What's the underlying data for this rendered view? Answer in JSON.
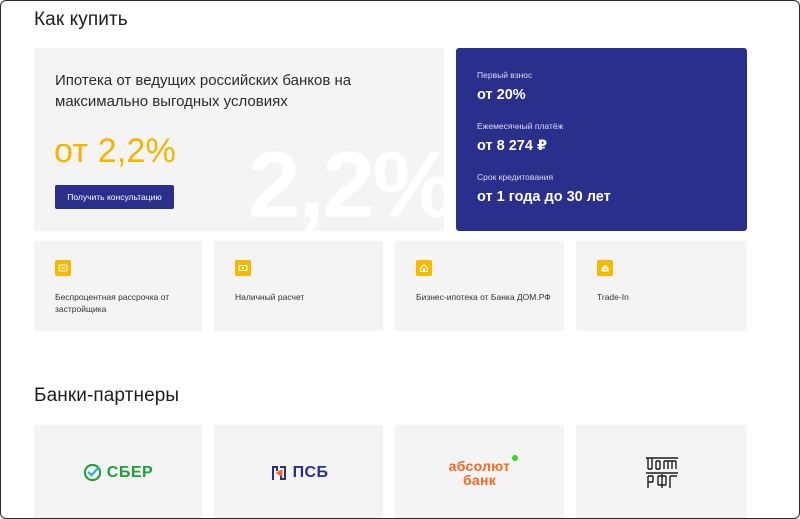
{
  "how_to_buy": {
    "title": "Как купить",
    "promo": {
      "title": "Ипотека от ведущих российских банков на максимально выгодных условиях",
      "rate": "от 2,2%",
      "background_rate": "2,2%",
      "button_label": "Получить консультацию"
    },
    "info": {
      "down_payment_label": "Первый взнос",
      "down_payment_value": "от 20%",
      "monthly_label": "Ежемесячный платёж",
      "monthly_value": "от 8 274 ₽",
      "term_label": "Срок кредитования",
      "term_value": "от 1 года до 30 лет"
    },
    "features": [
      {
        "label": "Беспроцентная рассрочка от застройщика",
        "icon": "installment-icon"
      },
      {
        "label": "Наличный расчет",
        "icon": "cash-icon"
      },
      {
        "label": "Бизнес-ипотека от Банка ДОМ.РФ",
        "icon": "business-mortgage-icon"
      },
      {
        "label": "Trade-In",
        "icon": "trade-in-icon"
      }
    ]
  },
  "partners": {
    "title": "Банки-партнеры",
    "banks": [
      {
        "name": "СБЕР"
      },
      {
        "name": "ПСБ"
      },
      {
        "line1": "абсолют",
        "line2": "банк"
      },
      {
        "name": "ДОМ РФ"
      }
    ]
  },
  "colors": {
    "accent_blue": "#2b2f8c",
    "accent_yellow": "#f5b400",
    "card_bg": "#f4f4f4",
    "sber_green": "#21a038",
    "absolut_orange": "#f26a21",
    "absolut_dot": "#35d62b"
  }
}
